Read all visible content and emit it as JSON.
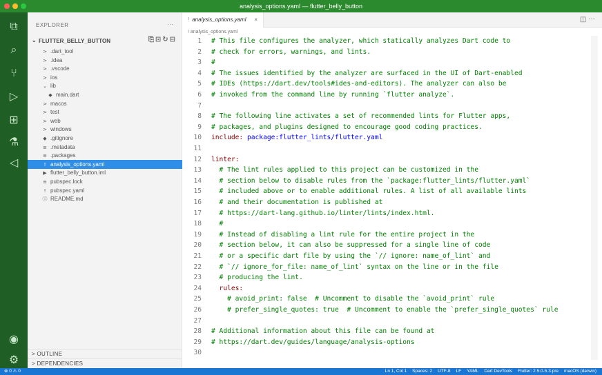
{
  "window": {
    "title": "analysis_options.yaml — flutter_belly_button"
  },
  "activity_icons": [
    "files-icon",
    "search-icon",
    "source-control-icon",
    "run-debug-icon",
    "extensions-icon",
    "flask-icon",
    "flutter-icon",
    "account-icon",
    "settings-icon"
  ],
  "sidebar": {
    "title": "EXPLORER",
    "more": "···",
    "project_name": "FLUTTER_BELLY_BUTTON",
    "tree": [
      {
        "label": ".dart_tool",
        "icon": ">",
        "indent": 1
      },
      {
        "label": ".idea",
        "icon": ">",
        "indent": 1
      },
      {
        "label": ".vscode",
        "icon": ">",
        "indent": 1
      },
      {
        "label": "ios",
        "icon": ">",
        "indent": 1
      },
      {
        "label": "lib",
        "icon": "⌄",
        "indent": 1
      },
      {
        "label": "main.dart",
        "icon": "◆",
        "indent": 2
      },
      {
        "label": "macos",
        "icon": ">",
        "indent": 1
      },
      {
        "label": "test",
        "icon": ">",
        "indent": 1
      },
      {
        "label": "web",
        "icon": ">",
        "indent": 1
      },
      {
        "label": "windows",
        "icon": ">",
        "indent": 1
      },
      {
        "label": ".gitignore",
        "icon": "◆",
        "indent": 1
      },
      {
        "label": ".metadata",
        "icon": "≡",
        "indent": 1
      },
      {
        "label": ".packages",
        "icon": "≡",
        "indent": 1
      },
      {
        "label": "analysis_options.yaml",
        "icon": "!",
        "indent": 1,
        "selected": true
      },
      {
        "label": "flutter_belly_button.iml",
        "icon": "▶",
        "indent": 1
      },
      {
        "label": "pubspec.lock",
        "icon": "≡",
        "indent": 1
      },
      {
        "label": "pubspec.yaml",
        "icon": "!",
        "indent": 1
      },
      {
        "label": "README.md",
        "icon": "ⓘ",
        "indent": 1
      }
    ],
    "outline": "OUTLINE",
    "dependencies": "DEPENDENCIES"
  },
  "editor": {
    "tab_label": "analysis_options.yaml",
    "breadcrumb": "! analysis_options.yaml",
    "lines": [
      {
        "n": "1",
        "t": "# This file configures the analyzer, which statically analyzes Dart code to"
      },
      {
        "n": "2",
        "t": "# check for errors, warnings, and lints."
      },
      {
        "n": "3",
        "t": "#"
      },
      {
        "n": "4",
        "t": "# The issues identified by the analyzer are surfaced in the UI of Dart-enabled"
      },
      {
        "n": "5",
        "t": "# IDEs (https://dart.dev/tools#ides-and-editors). The analyzer can also be"
      },
      {
        "n": "6",
        "t": "# invoked from the command line by running `flutter analyze`."
      },
      {
        "n": "7",
        "t": ""
      },
      {
        "n": "8",
        "t": "# The following line activates a set of recommended lints for Flutter apps,"
      },
      {
        "n": "9",
        "t": "# packages, and plugins designed to encourage good coding practices."
      },
      {
        "n": "10",
        "t": "include: ",
        "key": true,
        "val": "package:flutter_lints/flutter.yaml"
      },
      {
        "n": "11",
        "t": ""
      },
      {
        "n": "12",
        "t": "linter:",
        "key": true
      },
      {
        "n": "13",
        "t": "  # The lint rules applied to this project can be customized in the"
      },
      {
        "n": "14",
        "t": "  # section below to disable rules from the `package:flutter_lints/flutter.yaml`"
      },
      {
        "n": "15",
        "t": "  # included above or to enable additional rules. A list of all available lints"
      },
      {
        "n": "16",
        "t": "  # and their documentation is published at"
      },
      {
        "n": "17",
        "t": "  # https://dart-lang.github.io/linter/lints/index.html."
      },
      {
        "n": "18",
        "t": "  #"
      },
      {
        "n": "19",
        "t": "  # Instead of disabling a lint rule for the entire project in the"
      },
      {
        "n": "20",
        "t": "  # section below, it can also be suppressed for a single line of code"
      },
      {
        "n": "21",
        "t": "  # or a specific dart file by using the `// ignore: name_of_lint` and"
      },
      {
        "n": "22",
        "t": "  # `// ignore_for_file: name_of_lint` syntax on the line or in the file"
      },
      {
        "n": "23",
        "t": "  # producing the lint."
      },
      {
        "n": "24",
        "t": "  rules:",
        "key": true
      },
      {
        "n": "25",
        "t": "    # avoid_print: false  # Uncomment to disable the `avoid_print` rule"
      },
      {
        "n": "26",
        "t": "    # prefer_single_quotes: true  # Uncomment to enable the `prefer_single_quotes` rule"
      },
      {
        "n": "27",
        "t": ""
      },
      {
        "n": "28",
        "t": "# Additional information about this file can be found at"
      },
      {
        "n": "29",
        "t": "# https://dart.dev/guides/language/analysis-options"
      },
      {
        "n": "30",
        "t": ""
      }
    ]
  },
  "statusbar": {
    "problems": "⊗ 0 ⚠ 0",
    "items": [
      "Ln 1, Col 1",
      "Spaces: 2",
      "UTF-8",
      "LF",
      "YAML",
      "Dart DevTools",
      "Flutter: 2.5.0-5.3.pre",
      "macOS (darwin)"
    ]
  },
  "colors": {
    "title_bar": "#2c8a2e",
    "activity_bar": "#1f5e24",
    "selection": "#2f8ee8",
    "status_bar": "#1976d2",
    "comment": "#008000",
    "key": "#800000",
    "value": "#0000ff"
  }
}
